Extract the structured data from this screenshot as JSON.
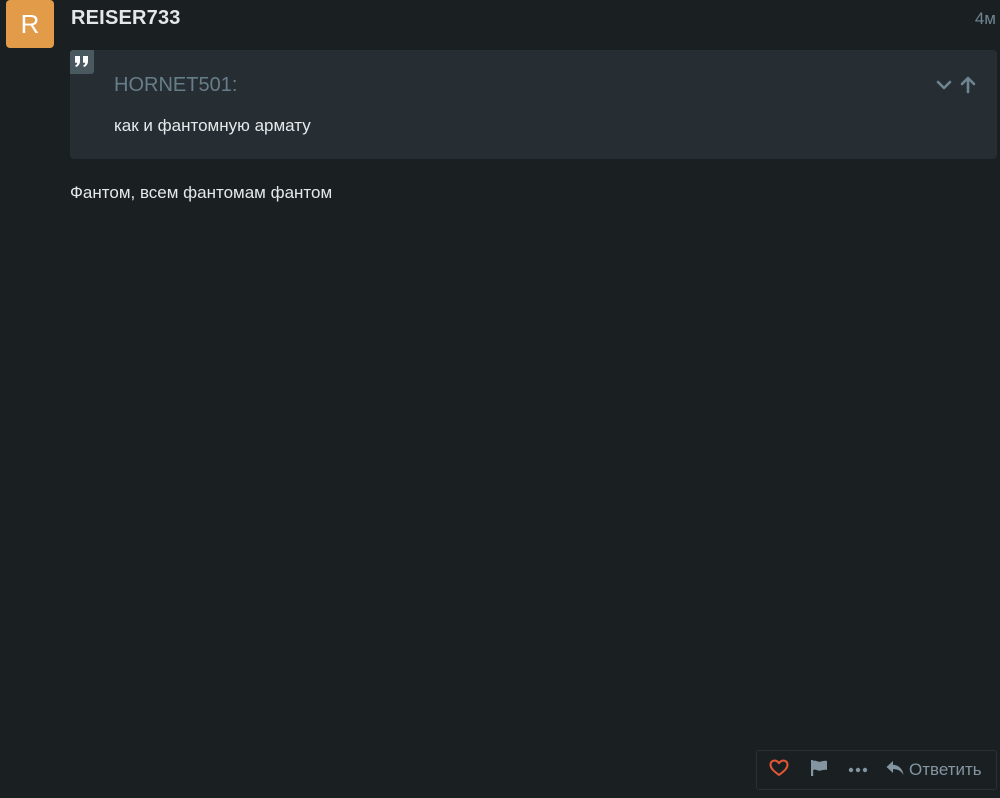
{
  "post": {
    "avatar_letter": "R",
    "username": "REISER733",
    "timestamp": "4м",
    "quote": {
      "author": "HORNET501:",
      "text": "как и фантомную армату"
    },
    "body": "Фантом, всем фантомам фантом"
  },
  "actions": {
    "reply_label": "Ответить"
  },
  "colors": {
    "background": "#1a1f22",
    "quote_background": "#262e33",
    "avatar": "#e29b48",
    "like": "#e45735",
    "muted": "#6f8591"
  },
  "icons": [
    "quote-icon",
    "chevron-down-icon",
    "arrow-up-icon",
    "heart-icon",
    "flag-icon",
    "ellipsis-icon",
    "reply-icon"
  ]
}
